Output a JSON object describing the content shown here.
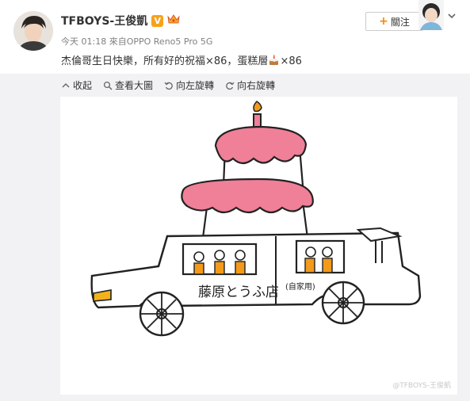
{
  "post": {
    "username": "TFBOYS-王俊凱",
    "meta_time": "今天 01:18",
    "meta_from": "來自",
    "meta_device": "OPPO Reno5 Pro 5G",
    "text_part1": "杰倫哥生日快樂，所有好的祝福×86，蛋糕層",
    "text_part2": "×86",
    "follow_label": "關注"
  },
  "toolbar": {
    "collapse": "收起",
    "view_large": "查看大圖",
    "rotate_left": "向左旋轉",
    "rotate_right": "向右旋轉"
  },
  "image": {
    "shop_name": "藤原とうふ店",
    "shop_sub": "(自家用)",
    "watermark": "@TFBOYS-王俊凱"
  },
  "colors": {
    "accent_orange": "#ff8200",
    "verified": "#f7a21b",
    "frosting": "#f07f98",
    "flame": "#f39a1b"
  }
}
